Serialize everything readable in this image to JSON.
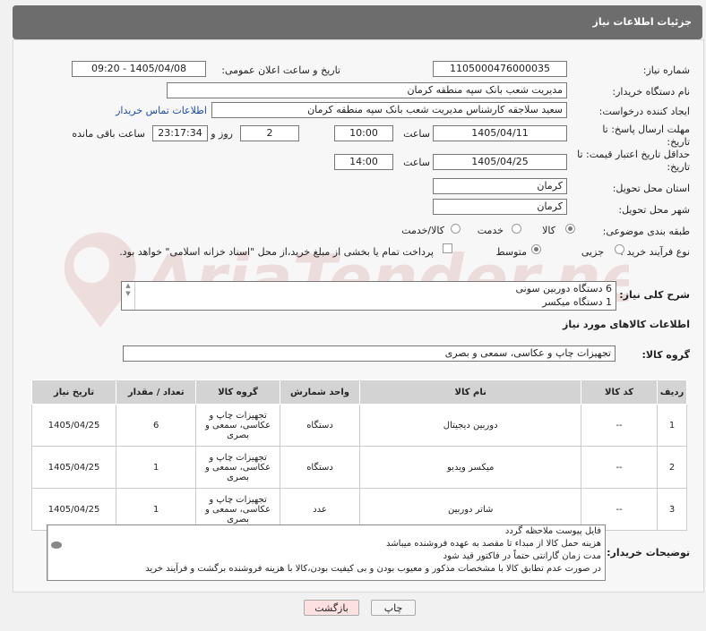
{
  "header": {
    "title": "جزئیات اطلاعات نیاز"
  },
  "fields": {
    "need_number_label": "شماره نیاز:",
    "need_number": "1105000476000035",
    "announce_label": "تاریخ و ساعت اعلان عمومی:",
    "announce_value": "1405/04/08 - 09:20",
    "buyer_org_label": "نام دستگاه خریدار:",
    "buyer_org": "مدیریت شعب بانک سپه منطقه کرمان",
    "creator_label": "ایجاد کننده درخواست:",
    "creator": "سعید سلاجقه کارشناس مدیریت شعب بانک سپه منطقه کرمان",
    "contact_link": "اطلاعات تماس خریدار",
    "deadline_label": "مهلت ارسال پاسخ: تا تاریخ:",
    "deadline_date": "1405/04/11",
    "time_label": "ساعت",
    "deadline_time": "10:00",
    "days_value": "2",
    "days_label": "روز و",
    "remaining_time": "23:17:34",
    "remaining_label": "ساعت باقی مانده",
    "price_validity_label": "حداقل تاریخ اعتبار قیمت: تا تاریخ:",
    "price_validity_date": "1405/04/25",
    "price_validity_time": "14:00",
    "province_label": "استان محل تحویل:",
    "province": "کرمان",
    "city_label": "شهر محل تحویل:",
    "city": "کرمان",
    "category_label": "طبقه بندی موضوعی:",
    "category_options": [
      "کالا",
      "خدمت",
      "کالا/خدمت"
    ],
    "process_label": "نوع فرآیند خرید :",
    "process_options": [
      "جزیی",
      "متوسط"
    ],
    "payment_note": "پرداخت تمام یا بخشی از مبلغ خرید،از محل \"اسناد خزانه اسلامی\" خواهد بود."
  },
  "summary": {
    "label": "شرح کلی نیاز:",
    "lines": [
      "6 دستگاه دوربین سونی",
      "1 دستگاه میکسر"
    ]
  },
  "items_section": {
    "title": "اطلاعات کالاهای مورد نیاز",
    "group_label": "گروه کالا:",
    "group_value": "تجهیزات چاپ و عکاسی، سمعی و بصری"
  },
  "table": {
    "headers": [
      "ردیف",
      "کد کالا",
      "نام کالا",
      "واحد شمارش",
      "گروه کالا",
      "تعداد / مقدار",
      "تاریخ نیاز"
    ],
    "rows": [
      {
        "row": "1",
        "code": "--",
        "name": "دوربین دیجیتال",
        "unit": "دستگاه",
        "group": "تجهیزات چاپ و عکاسی، سمعی و بصری",
        "qty": "6",
        "date": "1405/04/25"
      },
      {
        "row": "2",
        "code": "--",
        "name": "میکسر ویدیو",
        "unit": "دستگاه",
        "group": "تجهیزات چاپ و عکاسی، سمعی و بصری",
        "qty": "1",
        "date": "1405/04/25"
      },
      {
        "row": "3",
        "code": "--",
        "name": "شاتر دوربین",
        "unit": "عدد",
        "group": "تجهیزات چاپ و عکاسی، سمعی و بصری",
        "qty": "1",
        "date": "1405/04/25"
      }
    ]
  },
  "buyer_notes": {
    "label": "توضیحات خریدار:",
    "lines": [
      "فایل پیوست ملاحظه گردد",
      "هزینه حمل کالا از مبداء تا مقصد به عهده فروشنده میباشد",
      "مدت زمان گارانتی حتماً در فاکتور قید شود",
      "در صورت عدم تطابق کالا با مشخصات مذکور و معیوب بودن و بی کیفیت بودن،کالا با هزینه فروشنده برگشت و فرآیند خرید"
    ]
  },
  "buttons": {
    "print": "چاپ",
    "back": "بازگشت"
  },
  "watermark": {
    "text": "AriaTender.neT"
  }
}
